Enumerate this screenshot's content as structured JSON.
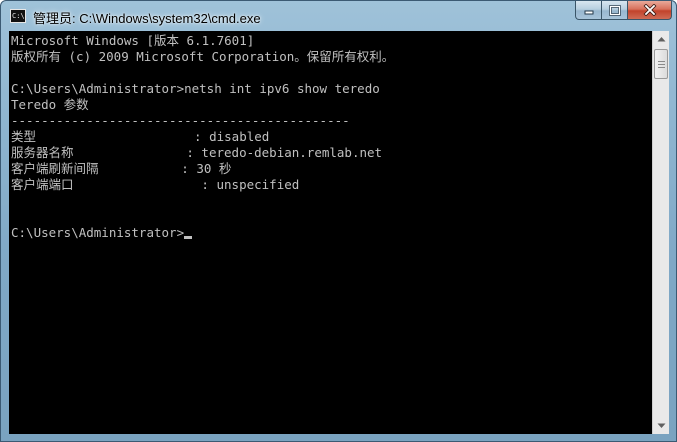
{
  "window": {
    "title": "管理员: C:\\Windows\\system32\\cmd.exe",
    "icon_label": "C:\\"
  },
  "console": {
    "lines": [
      "Microsoft Windows [版本 6.1.7601]",
      "版权所有 (c) 2009 Microsoft Corporation。保留所有权利。",
      "",
      "C:\\Users\\Administrator>netsh int ipv6 show teredo",
      "Teredo 参数",
      "---------------------------------------------",
      "类型                     : disabled",
      "服务器名称               : teredo-debian.remlab.net",
      "客户端刷新间隔           : 30 秒",
      "客户端端口                 : unspecified",
      "",
      "",
      "C:\\Users\\Administrator>"
    ]
  },
  "scrollbar": {
    "position": 0.0
  },
  "colors": {
    "console_bg": "#000000",
    "console_fg": "#c0c0c0",
    "close_button": "#c2432b"
  },
  "icons": {
    "minimize": "minimize-icon",
    "maximize": "maximize-icon",
    "close": "close-icon"
  }
}
